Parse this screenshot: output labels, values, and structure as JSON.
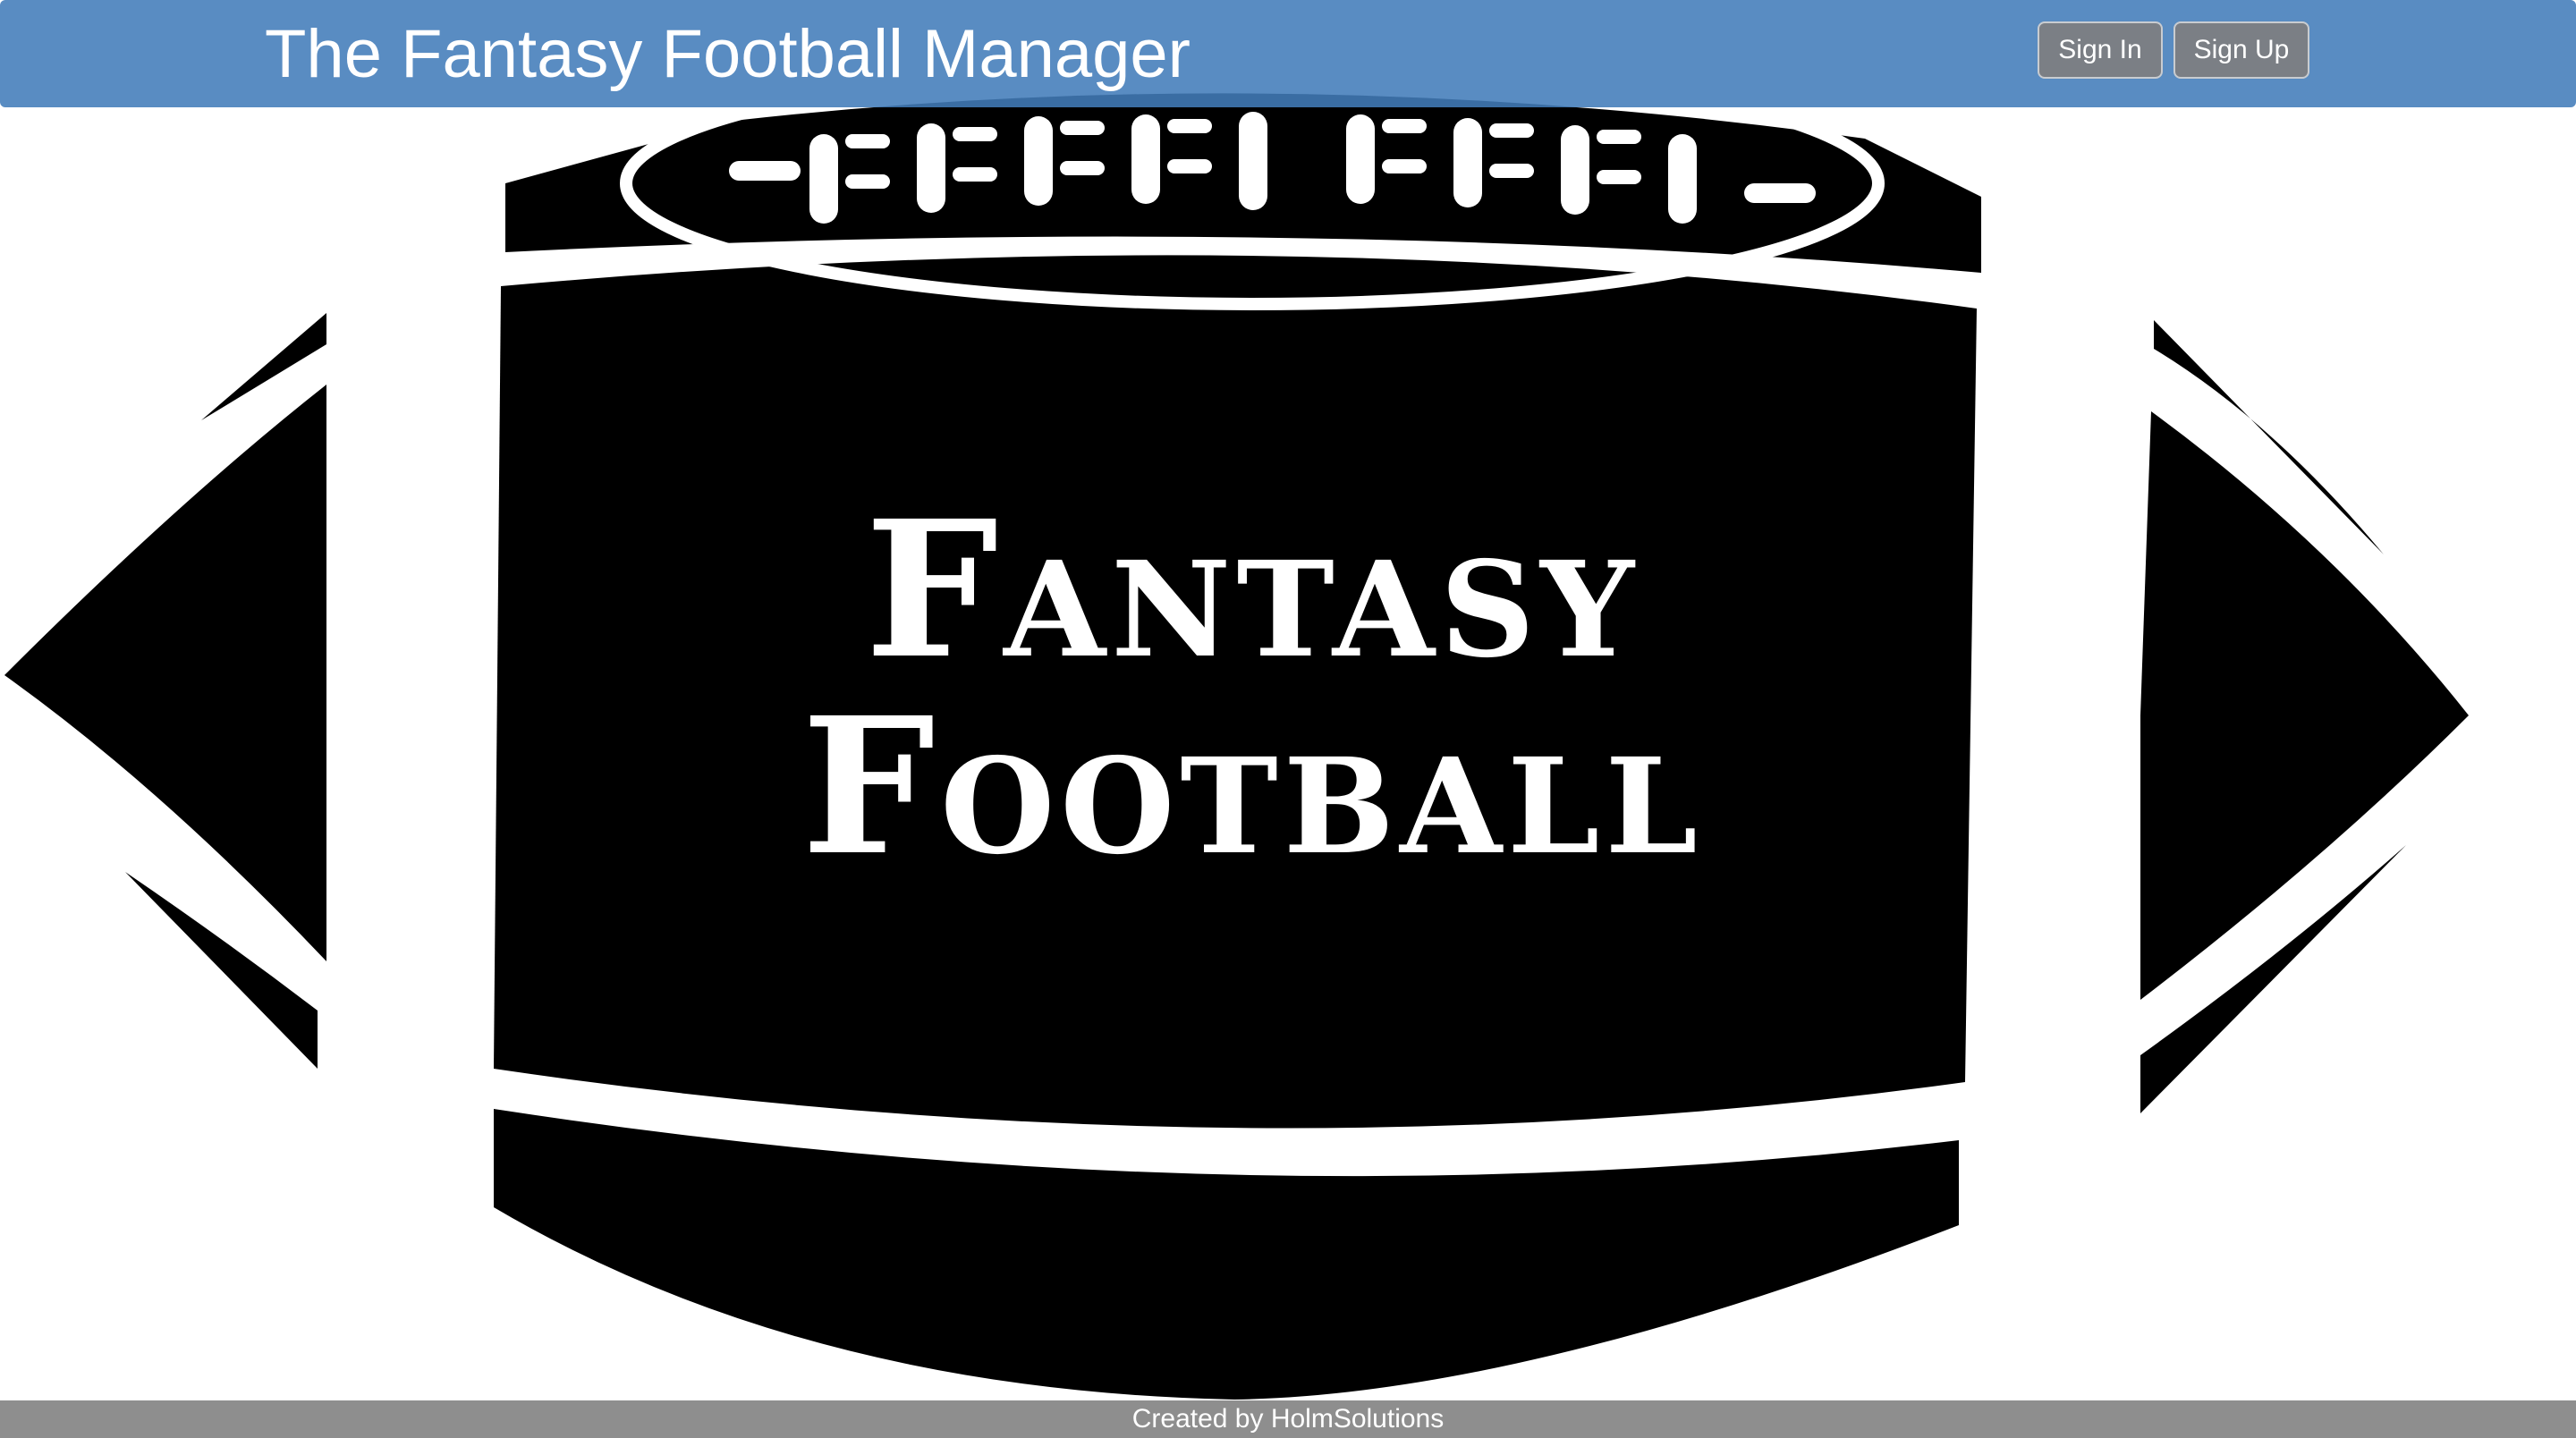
{
  "navbar": {
    "brand": "The Fantasy Football Manager",
    "sign_in_label": "Sign In",
    "sign_up_label": "Sign Up"
  },
  "hero": {
    "title_line1": "Fantasy",
    "title_line2": "Football"
  },
  "footer": {
    "credit": "Created by HolmSolutions"
  },
  "colors": {
    "navbar": "#427cba"
  },
  "icons": {
    "hero_art": "football-icon"
  }
}
